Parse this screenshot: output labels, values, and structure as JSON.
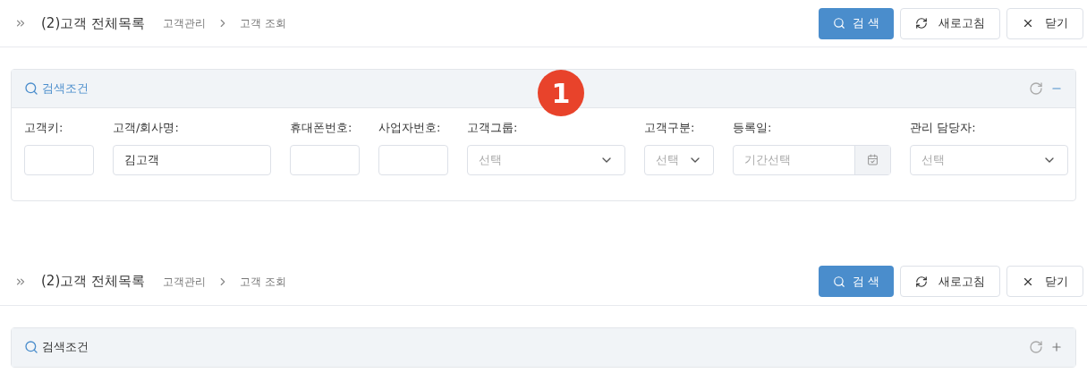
{
  "screens": [
    {
      "title": "(2)고객 전체목록",
      "breadcrumb": [
        "고객관리",
        "고객 조회"
      ],
      "buttons": [
        {
          "kind": "search",
          "label": "검 색"
        },
        {
          "kind": "refresh",
          "label": "새로고침"
        },
        {
          "kind": "close",
          "label": "닫기"
        }
      ],
      "panel": {
        "title": "검색조건",
        "expanded": true,
        "fields": [
          {
            "kind": "text",
            "label": "고객키:"
          },
          {
            "kind": "text",
            "label": "고객/회사명:",
            "value": "김고객"
          },
          {
            "kind": "text",
            "label": "휴대폰번호:"
          },
          {
            "kind": "text",
            "label": "사업자번호:"
          },
          {
            "kind": "select",
            "label": "고객그룹:",
            "placeholder": "선택"
          },
          {
            "kind": "select",
            "label": "고객구분:",
            "placeholder": "선택"
          },
          {
            "kind": "date",
            "label": "등록일:",
            "placeholder": "기간선택"
          },
          {
            "kind": "select",
            "label": "관리 담당자:",
            "placeholder": "선택"
          }
        ]
      }
    },
    {
      "title": "(2)고객 전체목록",
      "breadcrumb": [
        "고객관리",
        "고객 조회"
      ],
      "buttons": [
        {
          "kind": "search",
          "label": "검 색"
        },
        {
          "kind": "refresh",
          "label": "새로고침"
        },
        {
          "kind": "close",
          "label": "닫기"
        }
      ],
      "panel": {
        "title": "검색조건",
        "expanded": false
      }
    }
  ],
  "badge": "1"
}
